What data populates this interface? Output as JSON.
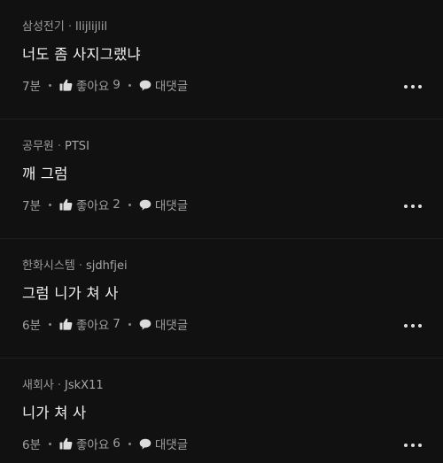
{
  "comments": [
    {
      "company": "삼성전기",
      "separator": "·",
      "nickname": "llijlijlil",
      "text": "너도 좀 사지그랬냐",
      "time": "7분",
      "like_label": "좋아요",
      "like_count": "9",
      "reply_label": "대댓글"
    },
    {
      "company": "공무원",
      "separator": "·",
      "nickname": "PTSI",
      "text": "깨 그럼",
      "time": "7분",
      "like_label": "좋아요",
      "like_count": "2",
      "reply_label": "대댓글"
    },
    {
      "company": "한화시스템",
      "separator": "·",
      "nickname": "sjdhfjei",
      "text": "그럼 니가 쳐 사",
      "time": "6분",
      "like_label": "좋아요",
      "like_count": "7",
      "reply_label": "대댓글"
    },
    {
      "company": "새회사",
      "separator": "·",
      "nickname": "JskX11",
      "text": "니가 쳐 사",
      "time": "6분",
      "like_label": "좋아요",
      "like_count": "6",
      "reply_label": "대댓글"
    }
  ],
  "icons": {
    "like": "thumbs-up-icon",
    "reply": "speech-bubble-icon",
    "more": "more-horizontal-icon"
  },
  "colors": {
    "background": "#111111",
    "text_primary": "#f0f0f0",
    "text_secondary": "#9a9a9a"
  }
}
